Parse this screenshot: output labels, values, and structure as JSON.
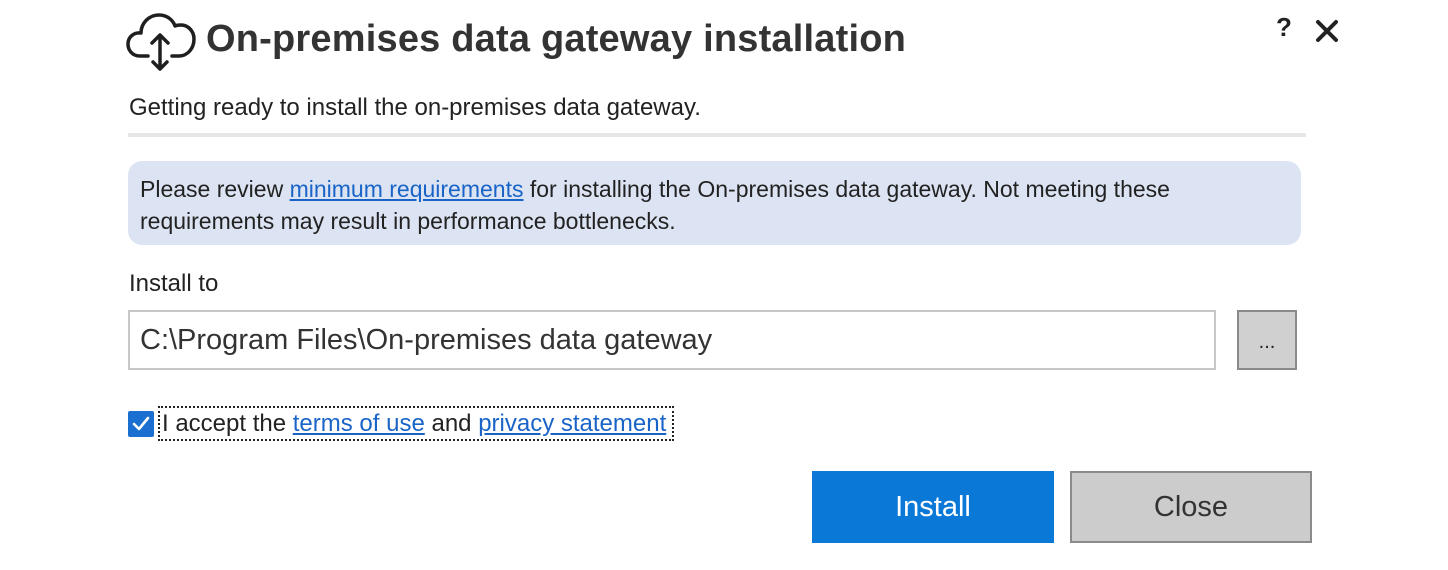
{
  "header": {
    "icon": "cloud-upload-icon",
    "title": "On-premises data gateway installation",
    "help_label": "?",
    "close_icon": "close-icon"
  },
  "subtitle": "Getting ready to install the on-premises data gateway.",
  "info": {
    "prefix": "Please review ",
    "link_text": "minimum requirements",
    "suffix": " for installing the On-premises data gateway. Not meeting these requirements may result in performance bottlenecks.",
    "background_color": "#dce4f3",
    "link_color": "#1a64c8"
  },
  "install_to": {
    "label": "Install to",
    "path_value": "C:\\Program Files\\On-premises data gateway",
    "browse_label": "..."
  },
  "terms": {
    "checked": true,
    "prefix": "I accept the ",
    "terms_link": "terms of use",
    "middle": " and ",
    "privacy_link": "privacy statement",
    "checkbox_color": "#1a6fd0"
  },
  "buttons": {
    "install_label": "Install",
    "close_label": "Close",
    "install_color": "#0a78d7"
  }
}
